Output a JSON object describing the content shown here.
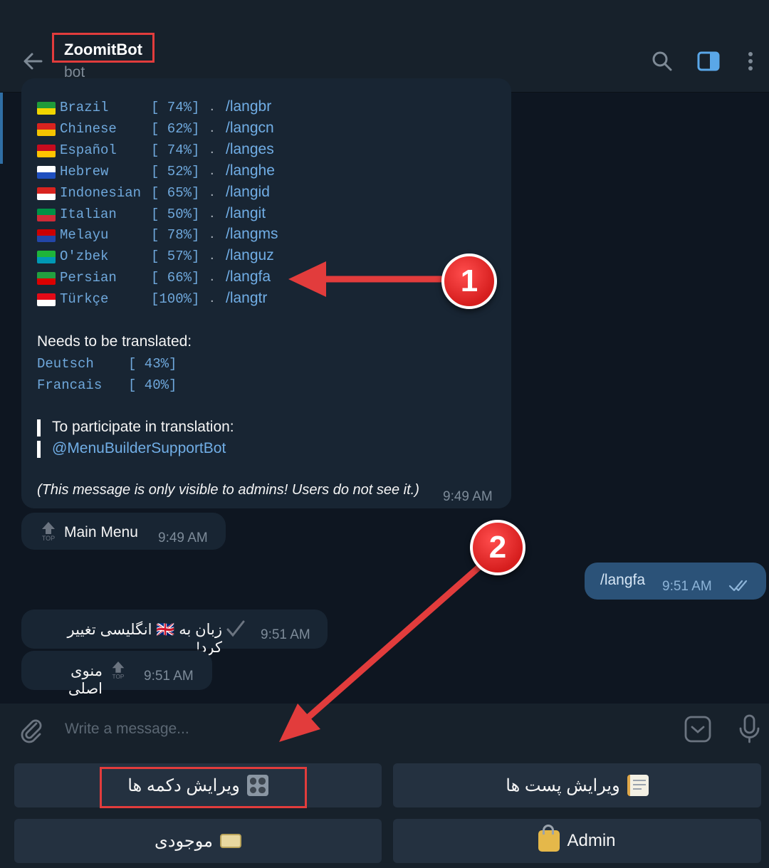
{
  "header": {
    "title": "ZoomitBot",
    "subtitle": "bot"
  },
  "languages": [
    {
      "name": "Brazil",
      "percent": "[ 74%]",
      "command": "/langbr"
    },
    {
      "name": "Chinese",
      "percent": "[ 62%]",
      "command": "/langcn"
    },
    {
      "name": "Español",
      "percent": "[ 74%]",
      "command": "/langes"
    },
    {
      "name": "Hebrew",
      "percent": "[ 52%]",
      "command": "/langhe"
    },
    {
      "name": "Indonesian",
      "percent": "[ 65%]",
      "command": "/langid"
    },
    {
      "name": "Italian",
      "percent": "[ 50%]",
      "command": "/langit"
    },
    {
      "name": "Melayu",
      "percent": "[ 78%]",
      "command": "/langms"
    },
    {
      "name": "O'zbek",
      "percent": "[ 57%]",
      "command": "/languz"
    },
    {
      "name": "Persian",
      "percent": "[ 66%]",
      "command": "/langfa"
    },
    {
      "name": "Türkçe",
      "percent": "[100%]",
      "command": "/langtr"
    }
  ],
  "needs_translation": {
    "heading": "Needs to be translated:",
    "items": [
      {
        "name": "Deutsch",
        "percent": "[ 43%]"
      },
      {
        "name": "Francais",
        "percent": "[ 40%]"
      }
    ]
  },
  "participate": {
    "line1": "To participate in translation:",
    "line2": "@MenuBuilderSupportBot"
  },
  "admin_note": "(This message is only visible to admins! Users do not see it.)",
  "messages": {
    "lang_list_time": "9:49 AM",
    "main_menu": {
      "text": "Main Menu",
      "time": "9:49 AM"
    },
    "outgoing": {
      "text": "/langfa",
      "time": "9:51 AM"
    },
    "changed": {
      "text": "زبان به 🇬🇧 انگلیسی تغییر کرد!",
      "time": "9:51 AM"
    },
    "main_menu_fa": {
      "text": "منوی اصلی",
      "time": "9:51 AM"
    }
  },
  "input": {
    "placeholder": "Write a message..."
  },
  "keyboard": {
    "edit_buttons": "ویرایش دکمه ها",
    "edit_posts": "ویرایش پست ها",
    "balance": "موجودی",
    "admin": "Admin"
  },
  "annotations": {
    "badge1": "1",
    "badge2": "2"
  },
  "icons": [
    "back-arrow-icon",
    "search-icon",
    "sidebar-toggle-icon",
    "more-vert-icon",
    "attach-icon",
    "bot-keyboard-icon",
    "microphone-icon",
    "read-check-icon",
    "top-icon"
  ],
  "colors": {
    "accent": "#71aee6",
    "annotation": "#e23c3c",
    "bubble_in": "#182533",
    "bubble_out": "#2b5278"
  }
}
